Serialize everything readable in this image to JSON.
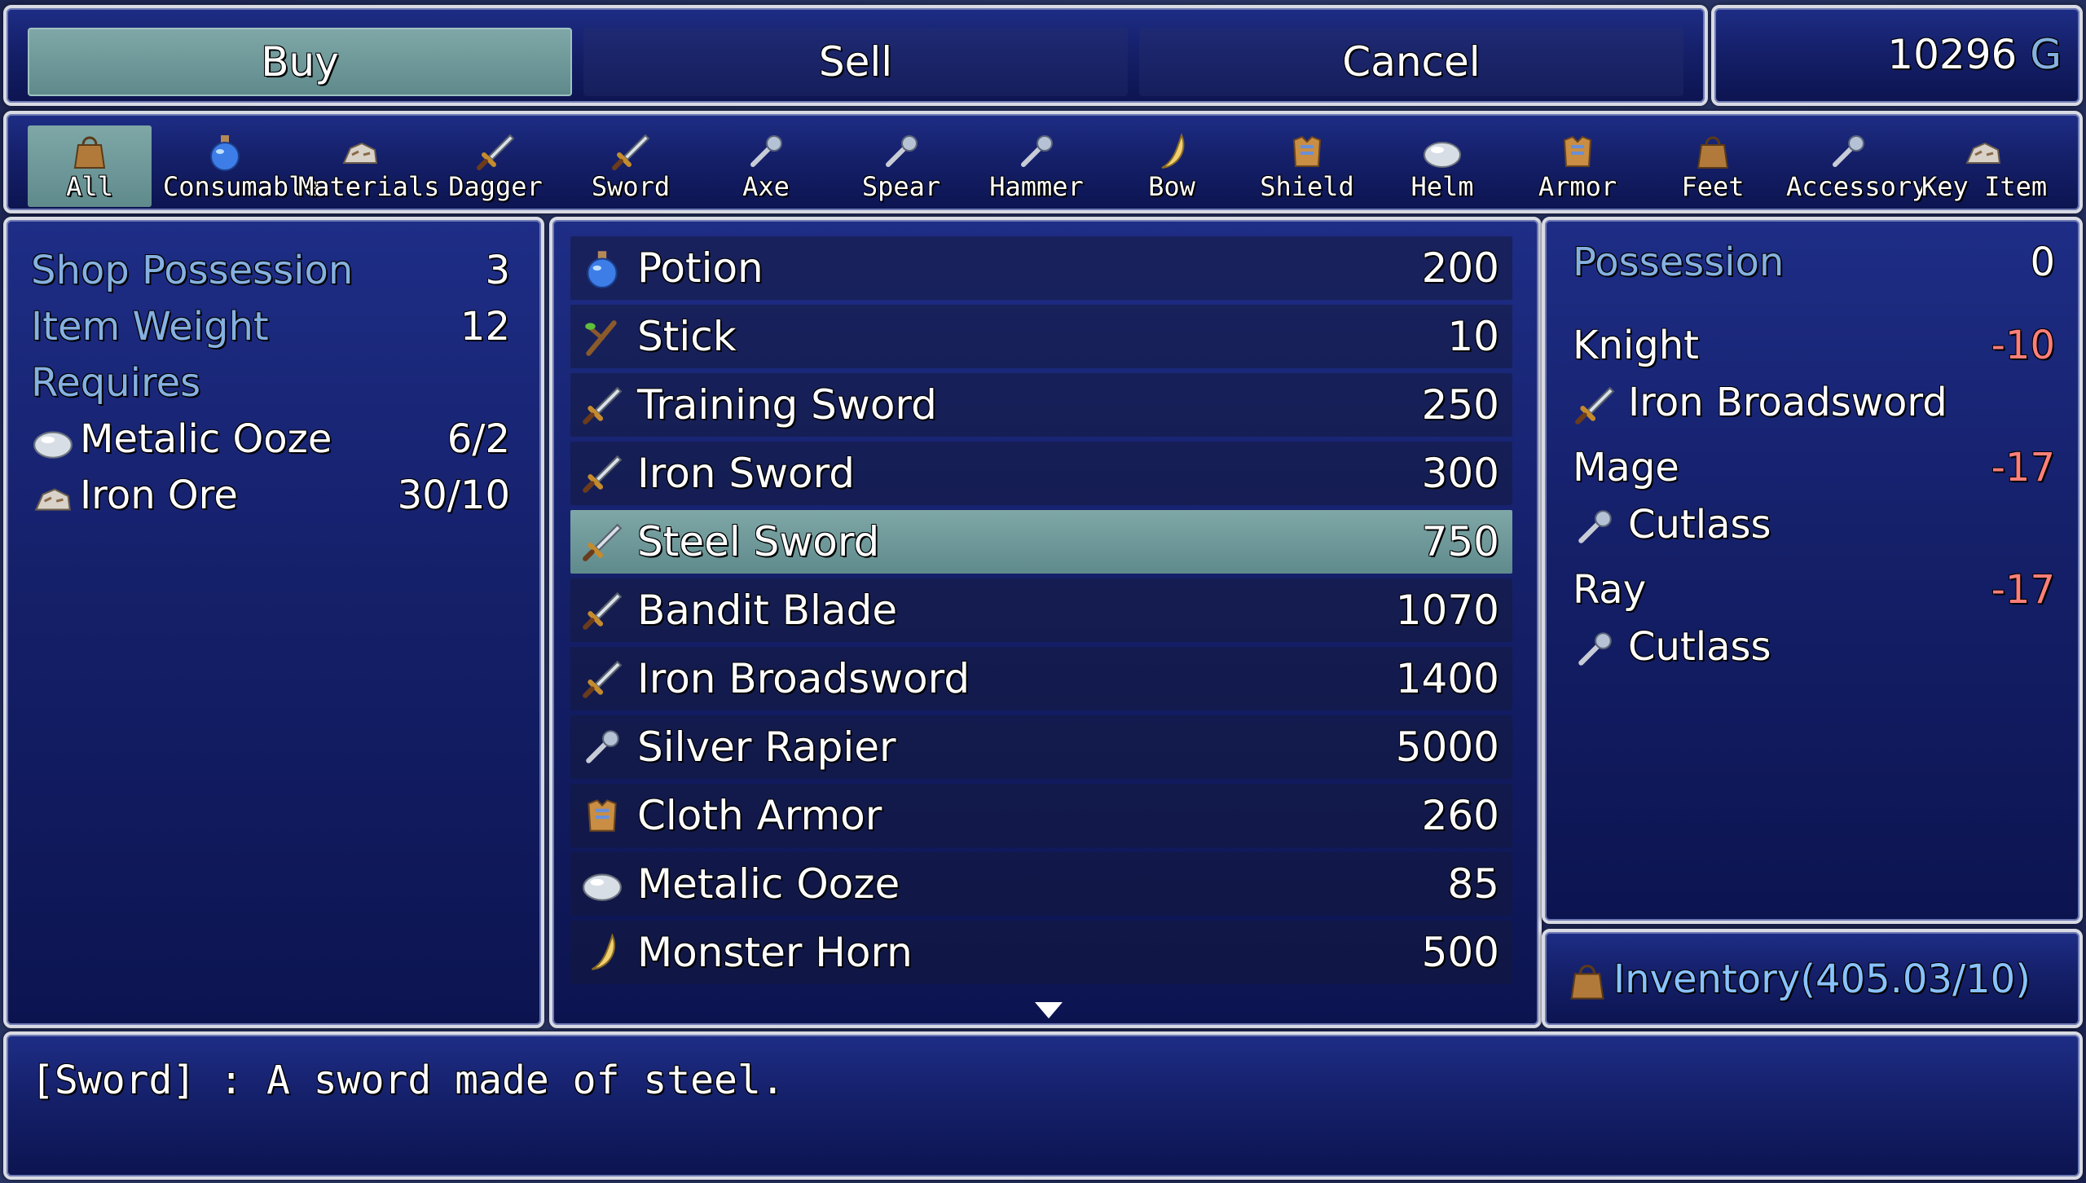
{
  "commands": [
    {
      "label": "Buy",
      "selected": true
    },
    {
      "label": "Sell",
      "selected": false
    },
    {
      "label": "Cancel",
      "selected": false
    }
  ],
  "gold": {
    "amount": "10296",
    "unit": "G"
  },
  "categories": [
    {
      "label": "All",
      "icon": "bag-icon",
      "selected": true
    },
    {
      "label": "Consumable",
      "icon": "potion-icon"
    },
    {
      "label": "Materials",
      "icon": "ore-icon"
    },
    {
      "label": "Dagger",
      "icon": "dagger-icon"
    },
    {
      "label": "Sword",
      "icon": "sword-icon"
    },
    {
      "label": "Axe",
      "icon": "axe-icon"
    },
    {
      "label": "Spear",
      "icon": "spear-icon"
    },
    {
      "label": "Hammer",
      "icon": "hammer-icon"
    },
    {
      "label": "Bow",
      "icon": "bow-icon"
    },
    {
      "label": "Shield",
      "icon": "shield-icon"
    },
    {
      "label": "Helm",
      "icon": "helm-icon"
    },
    {
      "label": "Armor",
      "icon": "armor-icon"
    },
    {
      "label": "Feet",
      "icon": "boots-icon"
    },
    {
      "label": "Accessory",
      "icon": "ring-icon"
    },
    {
      "label": "Key Item",
      "icon": "scroll-icon"
    }
  ],
  "info": {
    "shop_possession_label": "Shop Possession",
    "shop_possession_value": "3",
    "item_weight_label": "Item Weight",
    "item_weight_value": "12",
    "requires_label": "Requires",
    "requirements": [
      {
        "name": "Metalic Ooze",
        "value": "6/2",
        "icon": "ooze-icon"
      },
      {
        "name": "Iron Ore",
        "value": "30/10",
        "icon": "ore-icon"
      }
    ]
  },
  "items": [
    {
      "name": "Potion",
      "price": "200",
      "icon": "potion-icon"
    },
    {
      "name": "Stick",
      "price": "10",
      "icon": "stick-icon"
    },
    {
      "name": "Training Sword",
      "price": "250",
      "icon": "sword-icon"
    },
    {
      "name": "Iron Sword",
      "price": "300",
      "icon": "sword-icon"
    },
    {
      "name": "Steel Sword",
      "price": "750",
      "icon": "sword-icon",
      "selected": true
    },
    {
      "name": "Bandit Blade",
      "price": "1070",
      "icon": "blade-icon"
    },
    {
      "name": "Iron Broadsword",
      "price": "1400",
      "icon": "broadsword-icon"
    },
    {
      "name": "Silver Rapier",
      "price": "5000",
      "icon": "rapier-icon"
    },
    {
      "name": "Cloth Armor",
      "price": "260",
      "icon": "armor-icon"
    },
    {
      "name": "Metalic Ooze",
      "price": "85",
      "icon": "ooze-icon"
    },
    {
      "name": "Monster Horn",
      "price": "500",
      "icon": "horn-icon"
    }
  ],
  "status": {
    "possession_label": "Possession",
    "possession_value": "0",
    "actors": [
      {
        "name": "Knight",
        "diff": "-10",
        "equip": "Iron Broadsword"
      },
      {
        "name": "Mage",
        "diff": "-17",
        "equip": "Cutlass"
      },
      {
        "name": "Ray",
        "diff": "-17",
        "equip": "Cutlass"
      }
    ]
  },
  "inventory": {
    "label": "Inventory(405.03/10)",
    "icon": "bag-icon"
  },
  "help": {
    "text": "[Sword] : A sword made of steel."
  },
  "colors": {
    "system": "#85b1e0",
    "highlight": "#6f9a9a",
    "negative": "#ff7f7a"
  }
}
